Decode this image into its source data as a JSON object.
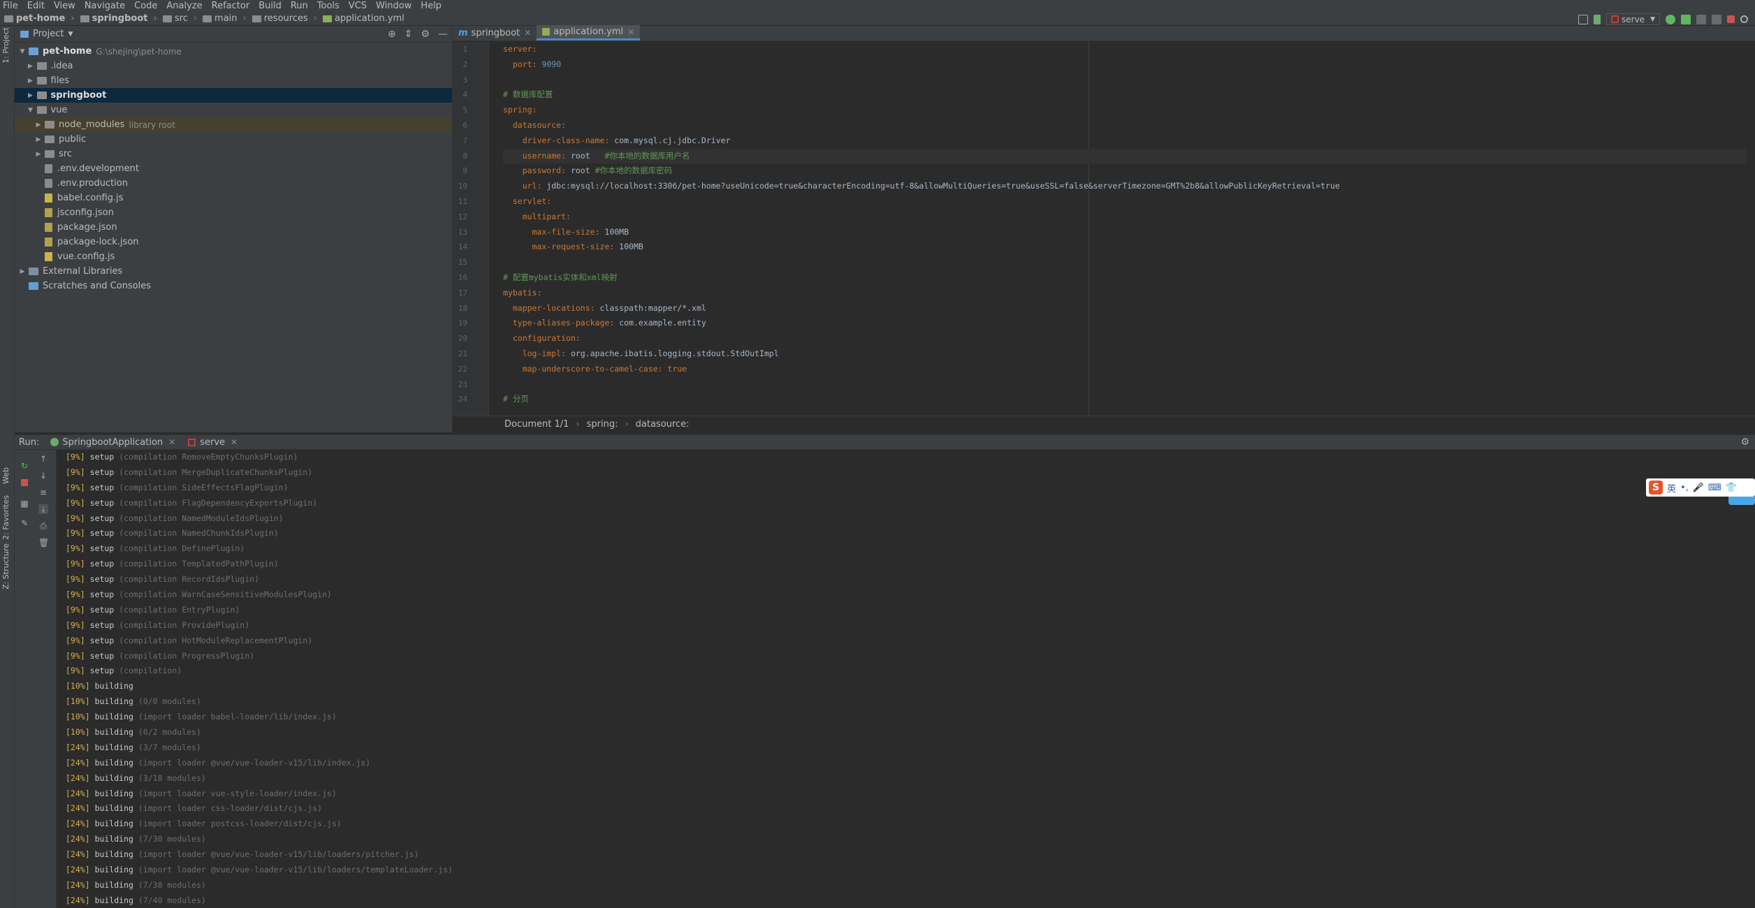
{
  "menu": [
    "File",
    "Edit",
    "View",
    "Navigate",
    "Code",
    "Analyze",
    "Refactor",
    "Build",
    "Run",
    "Tools",
    "VCS",
    "Window",
    "Help"
  ],
  "breadcrumbs": [
    "pet-home",
    "springboot",
    "src",
    "main",
    "resources",
    "application.yml"
  ],
  "run_config": "serve",
  "project_panel": {
    "title": "Project",
    "tree": [
      {
        "label": "pet-home",
        "hint": "G:\\shejing\\pet-home",
        "level": 0,
        "expanded": true,
        "type": "folder"
      },
      {
        "label": ".idea",
        "level": 1,
        "expanded": false,
        "type": "folder"
      },
      {
        "label": "files",
        "level": 1,
        "expanded": false,
        "type": "folder"
      },
      {
        "label": "springboot",
        "level": 1,
        "expanded": false,
        "type": "folder",
        "selected": true
      },
      {
        "label": "vue",
        "level": 1,
        "expanded": true,
        "type": "folder"
      },
      {
        "label": "node_modules",
        "hint": "library root",
        "level": 2,
        "expanded": false,
        "type": "folder",
        "library": true
      },
      {
        "label": "public",
        "level": 2,
        "expanded": false,
        "type": "folder"
      },
      {
        "label": "src",
        "level": 2,
        "expanded": false,
        "type": "folder"
      },
      {
        "label": ".env.development",
        "level": 2,
        "type": "file"
      },
      {
        "label": ".env.production",
        "level": 2,
        "type": "file"
      },
      {
        "label": "babel.config.js",
        "level": 2,
        "type": "file"
      },
      {
        "label": "jsconfig.json",
        "level": 2,
        "type": "file"
      },
      {
        "label": "package.json",
        "level": 2,
        "type": "file"
      },
      {
        "label": "package-lock.json",
        "level": 2,
        "type": "file"
      },
      {
        "label": "vue.config.js",
        "level": 2,
        "type": "file"
      },
      {
        "label": "External Libraries",
        "level": 0,
        "expanded": false,
        "type": "library"
      },
      {
        "label": "Scratches and Consoles",
        "level": 0,
        "type": "scratch"
      }
    ]
  },
  "editor": {
    "tabs": [
      {
        "label": "springboot",
        "active": false
      },
      {
        "label": "application.yml",
        "active": true
      }
    ],
    "line_numbers": [
      "1",
      "2",
      "3",
      "4",
      "5",
      "6",
      "7",
      "8",
      "9",
      "10",
      "11",
      "12",
      "13",
      "14",
      "15",
      "16",
      "17",
      "18",
      "19",
      "20",
      "21",
      "22",
      "23",
      "24"
    ],
    "current_line": 8,
    "lines": [
      [
        {
          "t": "server:",
          "c": "k"
        }
      ],
      [
        {
          "t": "  port: ",
          "c": "k"
        },
        {
          "t": "9090",
          "c": "n"
        }
      ],
      [],
      [
        {
          "t": "# 数据库配置",
          "c": "c"
        }
      ],
      [
        {
          "t": "spring:",
          "c": "k"
        }
      ],
      [
        {
          "t": "  datasource:",
          "c": "k"
        }
      ],
      [
        {
          "t": "    driver-class-name: ",
          "c": "k"
        },
        {
          "t": "com.mysql.cj.jdbc.Driver",
          "c": "v"
        }
      ],
      [
        {
          "t": "    username: ",
          "c": "k"
        },
        {
          "t": "root   ",
          "c": "v"
        },
        {
          "t": "#你本地的数据库用户名",
          "c": "c"
        }
      ],
      [
        {
          "t": "    password: ",
          "c": "k"
        },
        {
          "t": "root ",
          "c": "v"
        },
        {
          "t": "#你本地的数据库密码",
          "c": "c"
        }
      ],
      [
        {
          "t": "    url: ",
          "c": "k"
        },
        {
          "t": "jdbc:mysql://localhost:3306/pet-home?useUnicode=true&characterEncoding=utf-8&allowMultiQueries=true&useSSL=false&serverTimezone=GMT%2b8&allowPublicKeyRetrieval=true",
          "c": "v"
        }
      ],
      [
        {
          "t": "  servlet:",
          "c": "k"
        }
      ],
      [
        {
          "t": "    multipart:",
          "c": "k"
        }
      ],
      [
        {
          "t": "      max-file-size: ",
          "c": "k"
        },
        {
          "t": "100MB",
          "c": "v"
        }
      ],
      [
        {
          "t": "      max-request-size: ",
          "c": "k"
        },
        {
          "t": "100MB",
          "c": "v"
        }
      ],
      [],
      [
        {
          "t": "# 配置mybatis实体和xml映射",
          "c": "c"
        }
      ],
      [
        {
          "t": "mybatis:",
          "c": "k"
        }
      ],
      [
        {
          "t": "  mapper-locations: ",
          "c": "k"
        },
        {
          "t": "classpath:mapper/*.xml",
          "c": "v"
        }
      ],
      [
        {
          "t": "  type-aliases-package: ",
          "c": "k"
        },
        {
          "t": "com.example.entity",
          "c": "v"
        }
      ],
      [
        {
          "t": "  configuration:",
          "c": "k"
        }
      ],
      [
        {
          "t": "    log-impl: ",
          "c": "k"
        },
        {
          "t": "org.apache.ibatis.logging.stdout.StdOutImpl",
          "c": "v"
        }
      ],
      [
        {
          "t": "    map-underscore-to-camel-case: ",
          "c": "k"
        },
        {
          "t": "true",
          "c": "k"
        }
      ],
      [],
      [
        {
          "t": "# 分页",
          "c": "c"
        }
      ]
    ],
    "status_breadcrumb": [
      "Document 1/1",
      "spring:",
      "datasource:"
    ]
  },
  "run_panel": {
    "label": "Run:",
    "tabs": [
      {
        "label": "SpringbootApplication"
      },
      {
        "label": "serve"
      }
    ],
    "output": [
      [
        "[9%]",
        "setup",
        "(compilation RemoveEmptyChunksPlugin)"
      ],
      [
        "[9%]",
        "setup",
        "(compilation MergeDuplicateChunksPlugin)"
      ],
      [
        "[9%]",
        "setup",
        "(compilation SideEffectsFlagPlugin)"
      ],
      [
        "[9%]",
        "setup",
        "(compilation FlagDependencyExportsPlugin)"
      ],
      [
        "[9%]",
        "setup",
        "(compilation NamedModuleIdsPlugin)"
      ],
      [
        "[9%]",
        "setup",
        "(compilation NamedChunkIdsPlugin)"
      ],
      [
        "[9%]",
        "setup",
        "(compilation DefinePlugin)"
      ],
      [
        "[9%]",
        "setup",
        "(compilation TemplatedPathPlugin)"
      ],
      [
        "[9%]",
        "setup",
        "(compilation RecordIdsPlugin)"
      ],
      [
        "[9%]",
        "setup",
        "(compilation WarnCaseSensitiveModulesPlugin)"
      ],
      [
        "[9%]",
        "setup",
        "(compilation EntryPlugin)"
      ],
      [
        "[9%]",
        "setup",
        "(compilation ProvidePlugin)"
      ],
      [
        "[9%]",
        "setup",
        "(compilation HotModuleReplacementPlugin)"
      ],
      [
        "[9%]",
        "setup",
        "(compilation ProgressPlugin)"
      ],
      [
        "[9%]",
        "setup",
        "(compilation)"
      ],
      [
        "[10%]",
        "building",
        ""
      ],
      [
        "[10%]",
        "building",
        "(0/0 modules)"
      ],
      [
        "[10%]",
        "building",
        "(import loader babel-loader/lib/index.js)"
      ],
      [
        "[10%]",
        "building",
        "(0/2 modules)"
      ],
      [
        "[24%]",
        "building",
        "(3/7 modules)"
      ],
      [
        "[24%]",
        "building",
        "(import loader @vue/vue-loader-v15/lib/index.js)"
      ],
      [
        "[24%]",
        "building",
        "(3/18 modules)"
      ],
      [
        "[24%]",
        "building",
        "(import loader vue-style-loader/index.js)"
      ],
      [
        "[24%]",
        "building",
        "(import loader css-loader/dist/cjs.js)"
      ],
      [
        "[24%]",
        "building",
        "(import loader postcss-loader/dist/cjs.js)"
      ],
      [
        "[24%]",
        "building",
        "(7/30 modules)"
      ],
      [
        "[24%]",
        "building",
        "(import loader @vue/vue-loader-v15/lib/loaders/pitcher.js)"
      ],
      [
        "[24%]",
        "building",
        "(import loader @vue/vue-loader-v15/lib/loaders/templateLoader.js)"
      ],
      [
        "[24%]",
        "building",
        "(7/38 modules)"
      ],
      [
        "[24%]",
        "building",
        "(7/40 modules)"
      ]
    ]
  },
  "left_strip": {
    "project": "1: Project",
    "web": "Web",
    "favorites": "2: Favorites",
    "structure": "Z: Structure"
  },
  "ime": {
    "label": "英"
  }
}
